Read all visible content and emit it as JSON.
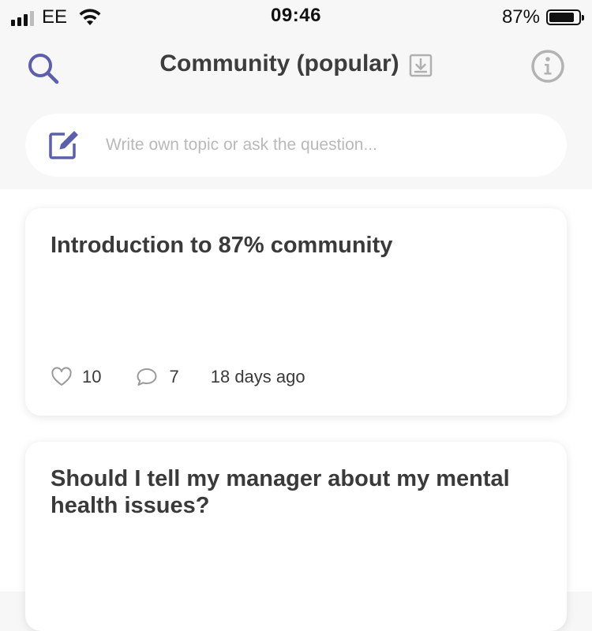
{
  "status_bar": {
    "carrier": "EE",
    "time": "09:46",
    "battery": "87%",
    "battery_level": 0.87
  },
  "header": {
    "title": "Community (popular)",
    "icons": [
      "search-icon",
      "download-icon",
      "info-icon"
    ],
    "accent_color": "#5b5fae"
  },
  "composer": {
    "placeholder": "Write own topic or ask the question..."
  },
  "posts": [
    {
      "title": "Introduction to 87% community",
      "likes": "10",
      "comments": "7",
      "time_ago": "18 days ago"
    },
    {
      "title": "Should I tell my manager about my mental health issues?"
    }
  ]
}
